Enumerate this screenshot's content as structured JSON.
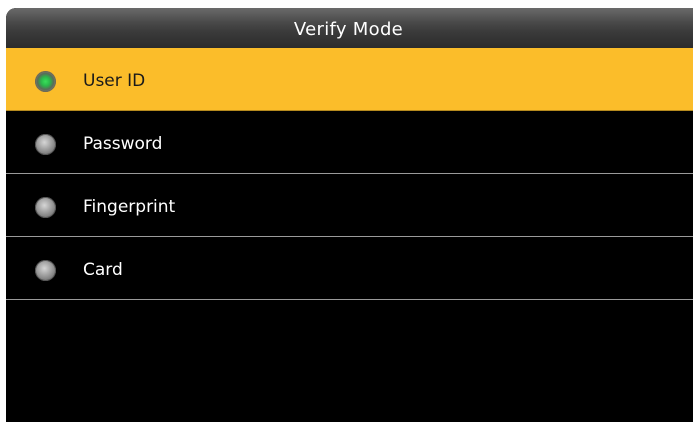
{
  "header": {
    "title": "Verify Mode"
  },
  "options": [
    {
      "label": "User ID",
      "selected": true
    },
    {
      "label": "Password",
      "selected": false
    },
    {
      "label": "Fingerprint",
      "selected": false
    },
    {
      "label": "Card",
      "selected": false
    }
  ],
  "colors": {
    "highlight": "#fbbd2a",
    "background": "#000000",
    "radio_selected": "#2bb84a",
    "radio_unselected": "#a8a8a8"
  },
  "icons": {
    "radio_selected": "radio-selected-icon",
    "radio_unselected": "radio-unselected-icon"
  }
}
